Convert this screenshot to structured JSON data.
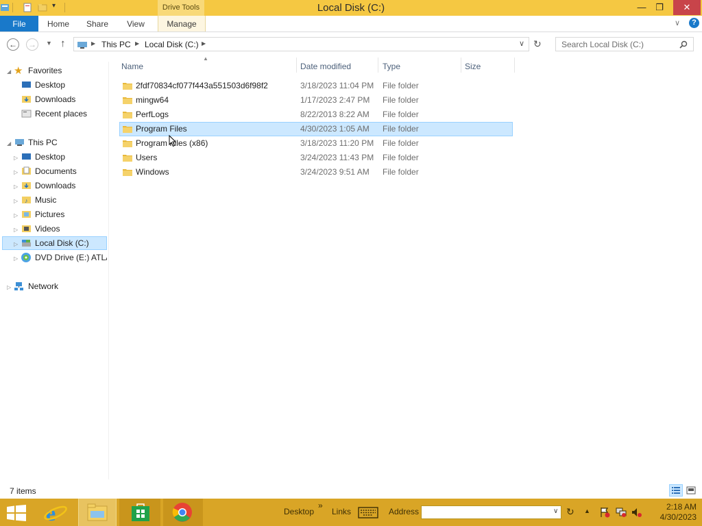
{
  "window": {
    "title": "Local Disk (C:)",
    "context_tab": "Drive Tools",
    "min_label": "—",
    "restore_label": "❐",
    "close_label": "✕"
  },
  "ribbon": {
    "tabs": [
      "File",
      "Home",
      "Share",
      "View",
      "Manage"
    ]
  },
  "nav": {
    "back_icon": "←",
    "forward_icon": "→",
    "up_icon": "↑",
    "breadcrumb": [
      "This PC",
      "Local Disk (C:)"
    ],
    "search_placeholder": "Search Local Disk (C:)"
  },
  "sidebar": {
    "favorites": {
      "label": "Favorites",
      "items": [
        "Desktop",
        "Downloads",
        "Recent places"
      ]
    },
    "thispc": {
      "label": "This PC",
      "items": [
        "Desktop",
        "Documents",
        "Downloads",
        "Music",
        "Pictures",
        "Videos",
        "Local Disk (C:)",
        "DVD Drive (E:) ATLA"
      ]
    },
    "network": "Network"
  },
  "columns": [
    "Name",
    "Date modified",
    "Type",
    "Size"
  ],
  "files": [
    {
      "name": "2fdf70834cf077f443a551503d6f98f2",
      "date": "3/18/2023 11:04 PM",
      "type": "File folder"
    },
    {
      "name": "mingw64",
      "date": "1/17/2023 2:47 PM",
      "type": "File folder"
    },
    {
      "name": "PerfLogs",
      "date": "8/22/2013 8:22 AM",
      "type": "File folder"
    },
    {
      "name": "Program Files",
      "date": "4/30/2023 1:05 AM",
      "type": "File folder"
    },
    {
      "name": "Program Files (x86)",
      "date": "3/18/2023 11:20 PM",
      "type": "File folder"
    },
    {
      "name": "Users",
      "date": "3/24/2023 11:43 PM",
      "type": "File folder"
    },
    {
      "name": "Windows",
      "date": "3/24/2023 9:51 AM",
      "type": "File folder"
    }
  ],
  "status": {
    "item_count": "7 items"
  },
  "taskbar": {
    "desktop": "Desktop",
    "links": "Links",
    "address": "Address",
    "chevron": "»",
    "time": "2:18 AM",
    "date": "4/30/2023"
  },
  "colors": {
    "accent": "#1979ca",
    "titlebar": "#f5c842",
    "taskbar": "#d9a526",
    "selection": "#cce8ff"
  }
}
